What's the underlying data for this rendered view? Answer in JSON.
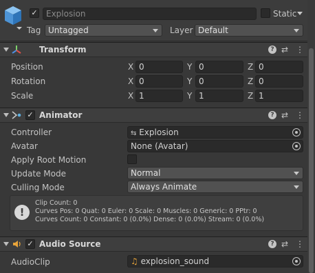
{
  "gameobject": {
    "name": "Explosion",
    "static_label": "Static",
    "tag_label": "Tag",
    "tag_value": "Untagged",
    "layer_label": "Layer",
    "layer_value": "Default"
  },
  "transform": {
    "title": "Transform",
    "rows": [
      {
        "label": "Position",
        "x": "0",
        "y": "0",
        "z": "0"
      },
      {
        "label": "Rotation",
        "x": "0",
        "y": "0",
        "z": "0"
      },
      {
        "label": "Scale",
        "x": "1",
        "y": "1",
        "z": "1"
      }
    ],
    "axis_x": "X",
    "axis_y": "Y",
    "axis_z": "Z"
  },
  "animator": {
    "title": "Animator",
    "controller_label": "Controller",
    "controller_value": "Explosion",
    "avatar_label": "Avatar",
    "avatar_value": "None (Avatar)",
    "apply_root_motion_label": "Apply Root Motion",
    "update_mode_label": "Update Mode",
    "update_mode_value": "Normal",
    "culling_mode_label": "Culling Mode",
    "culling_mode_value": "Always Animate",
    "info_lines": [
      "Clip Count: 0",
      "Curves Pos: 0 Quat: 0 Euler: 0 Scale: 0 Muscles: 0 Generic: 0 PPtr: 0",
      "Curves Count: 0 Constant: 0 (0.0%) Dense: 0 (0.0%) Stream: 0 (0.0%)"
    ]
  },
  "audio_source": {
    "title": "Audio Source",
    "audioclip_label": "AudioClip",
    "audioclip_value": "explosion_sound"
  },
  "icons": {
    "header_help": "help-icon",
    "header_presets": "presets-icon",
    "header_menu": "context-menu-icon"
  },
  "glyphs": {
    "check": "✓",
    "help": "?",
    "presets": "⇄",
    "menu": "⋮",
    "info": "!",
    "controller": "⇆",
    "music": "♫"
  },
  "colors": {
    "background": "#383838",
    "header": "#3e3e3e",
    "field": "#2a2a2a",
    "cube_icon": "#5fa6e6",
    "audio_icon": "#e8a43a"
  }
}
